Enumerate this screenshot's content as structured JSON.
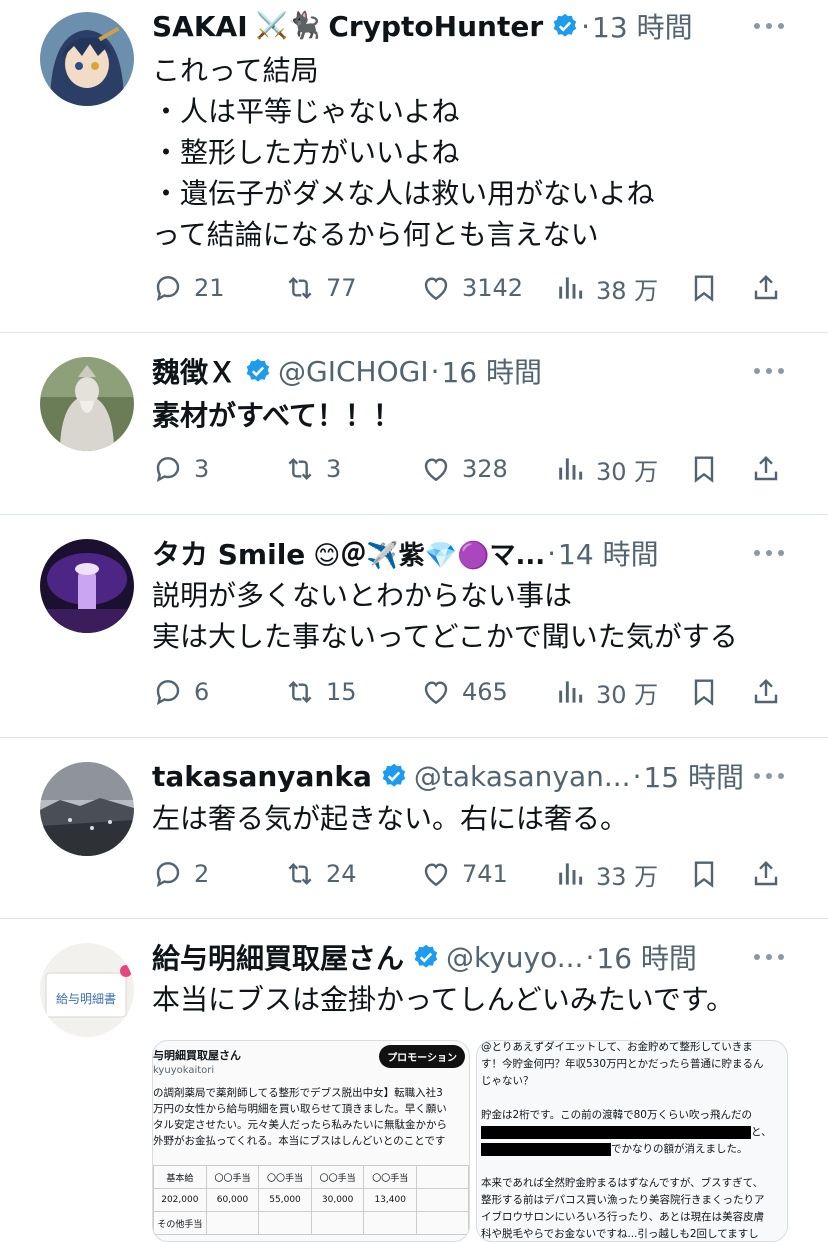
{
  "tweets": [
    {
      "name": "SAKAI",
      "emoji": "⚔️🐈‍⬛",
      "name2": "CryptoHunter",
      "verified": true,
      "handle": "",
      "time": "13 時間",
      "text": "これって結局\n・人は平等じゃないよね\n・整形した方がいいよね\n・遺伝子がダメな人は救い用がないよね\nって結論になるから何とも言えない",
      "replies": "21",
      "retweets": "77",
      "likes": "3142",
      "views": "38 万"
    },
    {
      "name": "魏徴Ｘ",
      "emoji": "",
      "name2": "",
      "verified": true,
      "handle": "@GICHOGI",
      "time": "16 時間",
      "text": "素材がすべて！！！",
      "replies": "3",
      "retweets": "3",
      "likes": "328",
      "views": "30 万"
    },
    {
      "name": "タカ Smile",
      "emoji": "😊＠✈️紫💎🟣マ...",
      "name2": "",
      "verified": false,
      "handle": "",
      "time": "14 時間",
      "text": "説明が多くないとわからない事は\n実は大した事ないってどこかで聞いた気がする",
      "replies": "6",
      "retweets": "15",
      "likes": "465",
      "views": "30 万"
    },
    {
      "name": "takasanyanka",
      "emoji": "",
      "name2": "",
      "verified": true,
      "handle": "@takasanyan...",
      "time": "15 時間",
      "text": "左は奢る気が起きない。右には奢る。",
      "replies": "2",
      "retweets": "24",
      "likes": "741",
      "views": "33 万"
    },
    {
      "name": "給与明細買取屋さん",
      "emoji": "",
      "name2": "",
      "verified": true,
      "handle": "@kyuyo...",
      "time": "16 時間",
      "text": "本当にブスは金掛かってしんどいみたいです。"
    }
  ],
  "media_left": {
    "header": "与明細買取屋さん",
    "handle": "kyuyokaitori",
    "promo": "プロモーション",
    "text": "の調剤薬局で薬剤師してる整形でデブス脱出中女】転職入社3\n万円の女性から給与明細を買い取らせて頂きました。早く願い\nタル安定させたい。元々美人だったら私みたいに無駄金かから\n外野がお金払ってくれる。本当にブスはしんどいとのことです",
    "table_header": [
      "基本給",
      "〇〇手当",
      "〇〇手当",
      "〇〇手当",
      "〇〇手当",
      ""
    ],
    "table_values": [
      "202,000",
      "60,000",
      "55,000",
      "30,000",
      "13,400",
      ""
    ],
    "table_row3": "その他手当"
  },
  "media_right": {
    "text1": "@とりあえずダイエットして、お金貯めて整形していきま\nす！今貯金何円？年収530万円とかだったら普通に貯まるん\nじゃない？",
    "text2": "貯金は2桁です。この前の渡韓で80万くらい吹っ飛んだの",
    "text3": "と、",
    "text4": "でかなりの額が消えました。",
    "text5": "本来であれば全然貯金貯まるはずなんですが、ブスすぎて、\n整形する前はデパコス買い漁ったり美容院行きまくったりア\nイブロウサロンにいろいろ行ったり、あとは現在は美容皮膚\n科や脱毛やらでお金ないですね...引っ越しも2回してますし"
  },
  "colors": {
    "text": "#0f1419",
    "secondary": "#536471",
    "verified": "#1d9bf0",
    "divider": "#e1e6ea"
  }
}
